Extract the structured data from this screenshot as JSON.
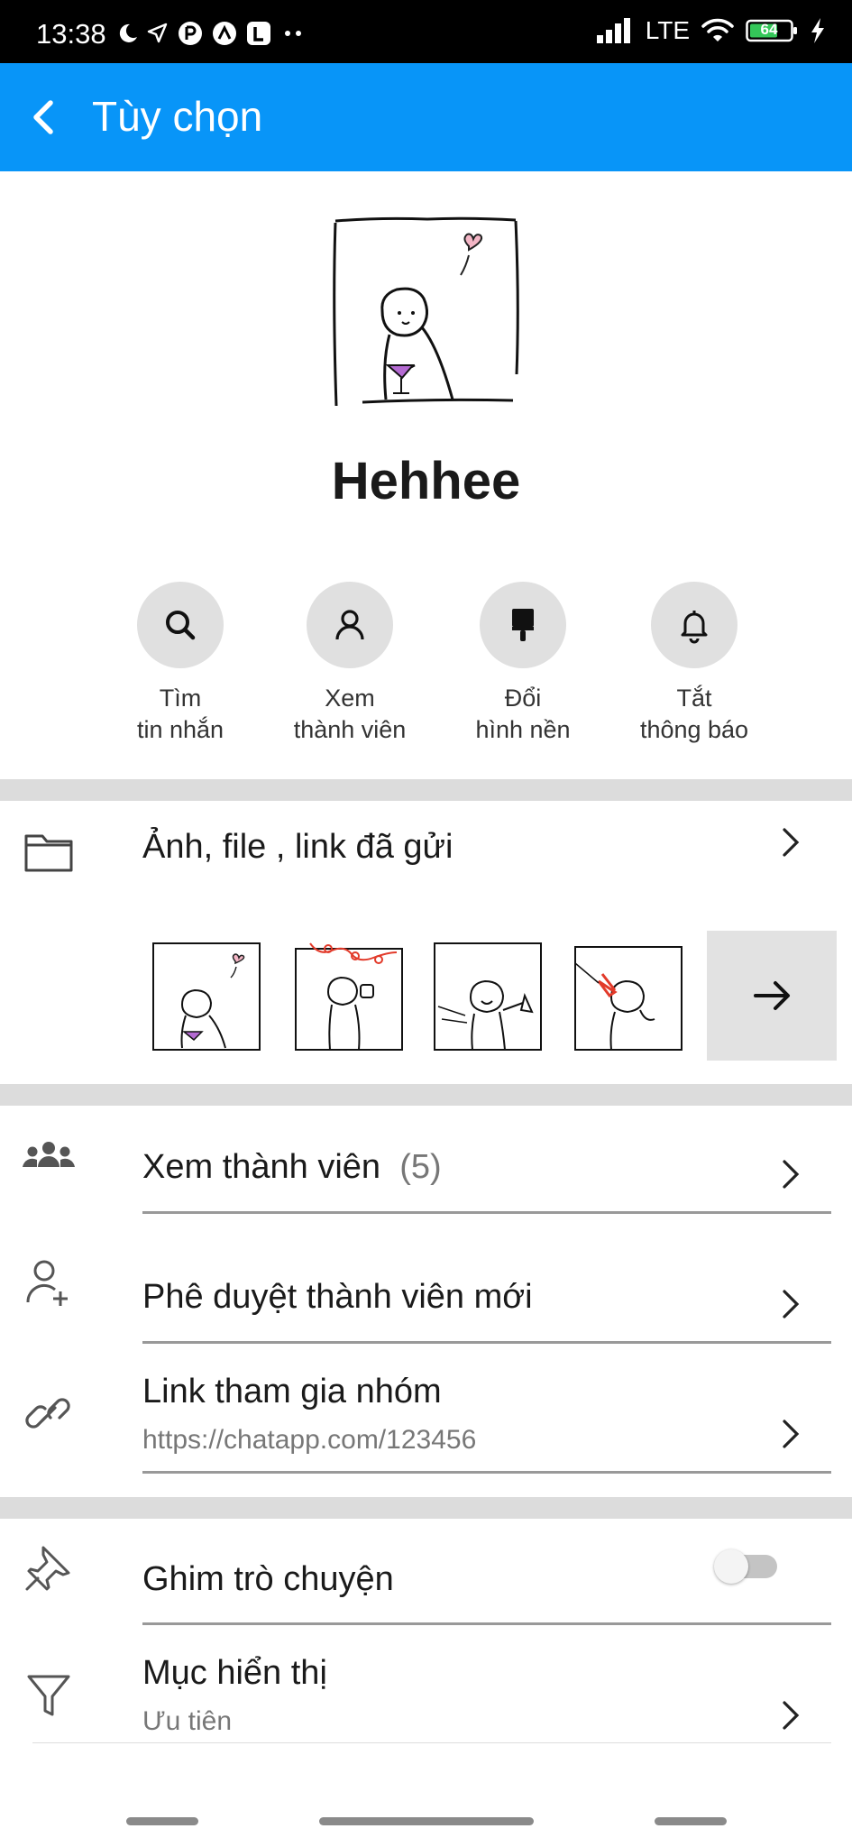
{
  "status_bar": {
    "time": "13:38",
    "network": "LTE",
    "battery": "64"
  },
  "header": {
    "title": "Tùy chọn"
  },
  "group": {
    "name": "Hehhee"
  },
  "actions": [
    {
      "line1": "Tìm",
      "line2": "tin nhắn",
      "icon": "search-icon"
    },
    {
      "line1": "Xem",
      "line2": "thành viên",
      "icon": "person-icon"
    },
    {
      "line1": "Đổi",
      "line2": "hình nền",
      "icon": "paint-brush-icon"
    },
    {
      "line1": "Tắt",
      "line2": "thông báo",
      "icon": "bell-icon"
    }
  ],
  "media": {
    "title": "Ảnh, file , link đã gửi"
  },
  "members": {
    "title": "Xem thành viên",
    "count": "(5)"
  },
  "approve": {
    "title": "Phê duyệt thành viên mới"
  },
  "link": {
    "title": "Link tham gia nhóm",
    "url": "https://chatapp.com/123456"
  },
  "pin": {
    "title": "Ghim trò chuyện",
    "enabled": false
  },
  "display": {
    "title": "Mục hiển thị",
    "value": "Ưu tiên"
  },
  "colors": {
    "accent": "#0895f8",
    "divider": "#dcdcdc"
  }
}
